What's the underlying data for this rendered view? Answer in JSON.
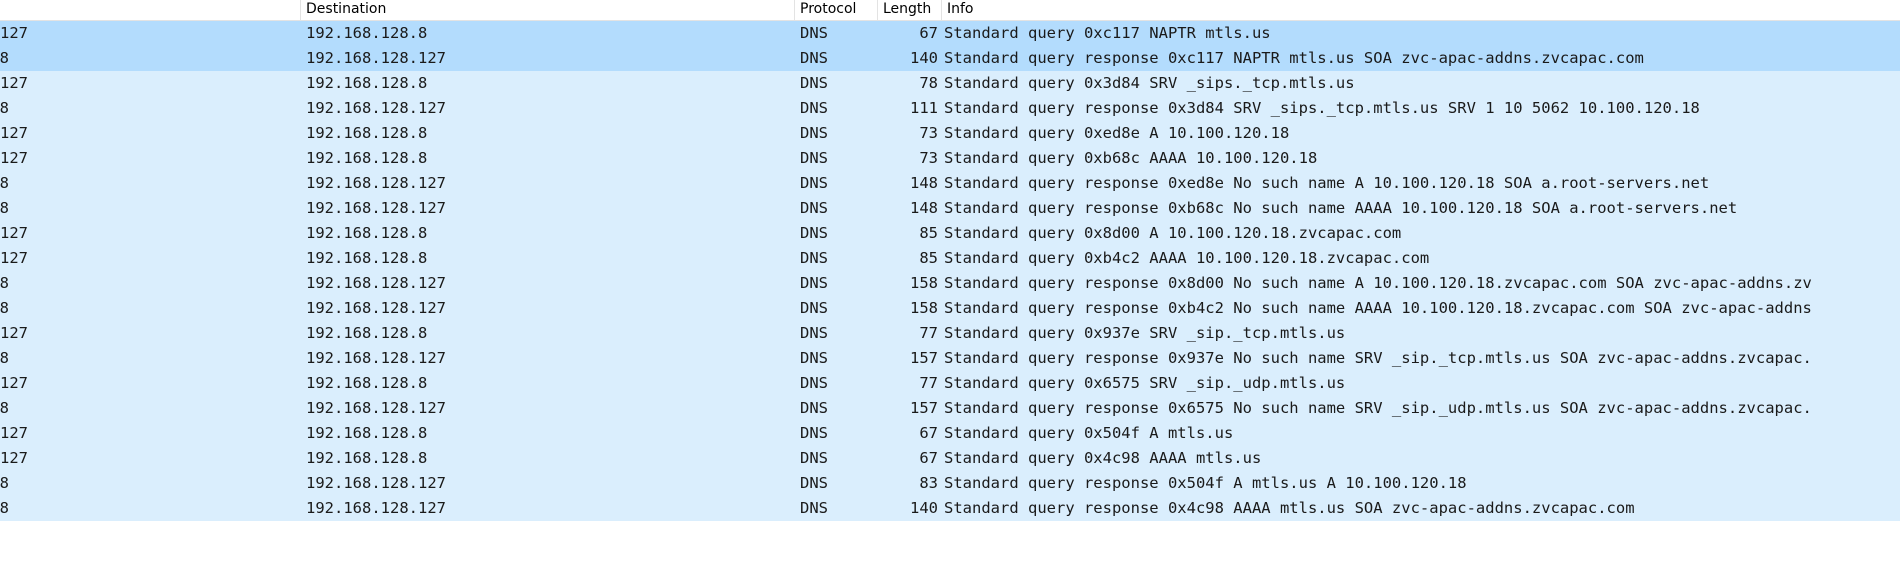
{
  "header": {
    "col_source": "",
    "col_destination": "Destination",
    "col_protocol": "Protocol",
    "col_length": "Length",
    "col_info": "Info"
  },
  "rows": [
    {
      "src": "127",
      "dst": "192.168.128.8",
      "proto": "DNS",
      "len": "67",
      "info": "Standard query 0xc117 NAPTR mtls.us"
    },
    {
      "src": "8",
      "dst": "192.168.128.127",
      "proto": "DNS",
      "len": "140",
      "info": "Standard query response 0xc117 NAPTR mtls.us SOA zvc-apac-addns.zvcapac.com"
    },
    {
      "src": "127",
      "dst": "192.168.128.8",
      "proto": "DNS",
      "len": "78",
      "info": "Standard query 0x3d84 SRV _sips._tcp.mtls.us"
    },
    {
      "src": "8",
      "dst": "192.168.128.127",
      "proto": "DNS",
      "len": "111",
      "info": "Standard query response 0x3d84 SRV _sips._tcp.mtls.us SRV 1 10 5062 10.100.120.18"
    },
    {
      "src": "127",
      "dst": "192.168.128.8",
      "proto": "DNS",
      "len": "73",
      "info": "Standard query 0xed8e A 10.100.120.18"
    },
    {
      "src": "127",
      "dst": "192.168.128.8",
      "proto": "DNS",
      "len": "73",
      "info": "Standard query 0xb68c AAAA 10.100.120.18"
    },
    {
      "src": "8",
      "dst": "192.168.128.127",
      "proto": "DNS",
      "len": "148",
      "info": "Standard query response 0xed8e No such name A 10.100.120.18 SOA a.root-servers.net"
    },
    {
      "src": "8",
      "dst": "192.168.128.127",
      "proto": "DNS",
      "len": "148",
      "info": "Standard query response 0xb68c No such name AAAA 10.100.120.18 SOA a.root-servers.net"
    },
    {
      "src": "127",
      "dst": "192.168.128.8",
      "proto": "DNS",
      "len": "85",
      "info": "Standard query 0x8d00 A 10.100.120.18.zvcapac.com"
    },
    {
      "src": "127",
      "dst": "192.168.128.8",
      "proto": "DNS",
      "len": "85",
      "info": "Standard query 0xb4c2 AAAA 10.100.120.18.zvcapac.com"
    },
    {
      "src": "8",
      "dst": "192.168.128.127",
      "proto": "DNS",
      "len": "158",
      "info": "Standard query response 0x8d00 No such name A 10.100.120.18.zvcapac.com SOA zvc-apac-addns.zv"
    },
    {
      "src": "8",
      "dst": "192.168.128.127",
      "proto": "DNS",
      "len": "158",
      "info": "Standard query response 0xb4c2 No such name AAAA 10.100.120.18.zvcapac.com SOA zvc-apac-addns"
    },
    {
      "src": "127",
      "dst": "192.168.128.8",
      "proto": "DNS",
      "len": "77",
      "info": "Standard query 0x937e SRV _sip._tcp.mtls.us"
    },
    {
      "src": "8",
      "dst": "192.168.128.127",
      "proto": "DNS",
      "len": "157",
      "info": "Standard query response 0x937e No such name SRV _sip._tcp.mtls.us SOA zvc-apac-addns.zvcapac."
    },
    {
      "src": "127",
      "dst": "192.168.128.8",
      "proto": "DNS",
      "len": "77",
      "info": "Standard query 0x6575 SRV _sip._udp.mtls.us"
    },
    {
      "src": "8",
      "dst": "192.168.128.127",
      "proto": "DNS",
      "len": "157",
      "info": "Standard query response 0x6575 No such name SRV _sip._udp.mtls.us SOA zvc-apac-addns.zvcapac."
    },
    {
      "src": "127",
      "dst": "192.168.128.8",
      "proto": "DNS",
      "len": "67",
      "info": "Standard query 0x504f A mtls.us"
    },
    {
      "src": "127",
      "dst": "192.168.128.8",
      "proto": "DNS",
      "len": "67",
      "info": "Standard query 0x4c98 AAAA mtls.us"
    },
    {
      "src": "8",
      "dst": "192.168.128.127",
      "proto": "DNS",
      "len": "83",
      "info": "Standard query response 0x504f A mtls.us A 10.100.120.18"
    },
    {
      "src": "8",
      "dst": "192.168.128.127",
      "proto": "DNS",
      "len": "140",
      "info": "Standard query response 0x4c98 AAAA mtls.us SOA zvc-apac-addns.zvcapac.com"
    }
  ],
  "selected_rows": [
    0,
    1
  ],
  "colors": {
    "row_background": "#daeefd",
    "selected_row_background": "#b3dcfd",
    "page_background": "#ffffff"
  }
}
